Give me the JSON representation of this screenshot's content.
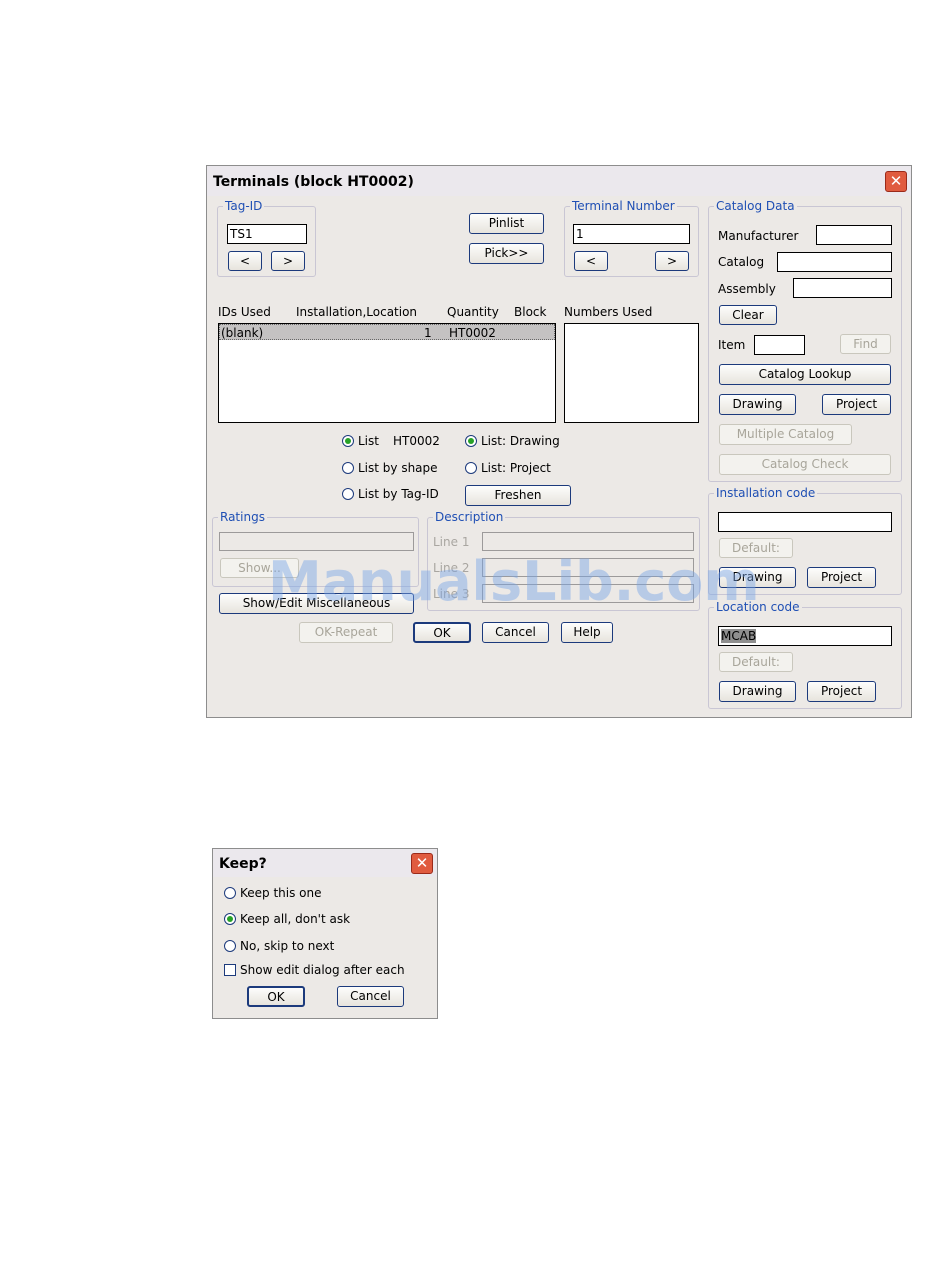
{
  "terminals": {
    "title": "Terminals (block HT0002)",
    "tag_id": {
      "legend": "Tag-ID",
      "value": "TS1",
      "prev": "<",
      "next": ">"
    },
    "pinlist": "Pinlist",
    "pick": "Pick>>",
    "terminal_number": {
      "legend": "Terminal Number",
      "value": "1",
      "prev": "<",
      "next": ">"
    },
    "list_headers": {
      "ids": "IDs Used",
      "inst_loc": "Installation,Location",
      "quantity": "Quantity",
      "block": "Block",
      "numbers": "Numbers Used"
    },
    "ids_rows": [
      {
        "id": "(blank)",
        "inst_loc": "",
        "quantity": "1",
        "block": "HT0002"
      }
    ],
    "radios": {
      "list": "List",
      "list_block": "HT0002",
      "list_by_shape": "List by shape",
      "list_by_tag": "List by Tag-ID",
      "list_drawing": "List: Drawing",
      "list_project": "List: Project"
    },
    "freshen": "Freshen",
    "ratings": {
      "legend": "Ratings",
      "show": "Show..."
    },
    "description": {
      "legend": "Description",
      "line1": "Line 1",
      "line2": "Line 2",
      "line3": "Line 3"
    },
    "show_edit_misc": "Show/Edit Miscellaneous",
    "ok_repeat": "OK-Repeat",
    "ok": "OK",
    "cancel": "Cancel",
    "help": "Help",
    "catalog": {
      "legend": "Catalog Data",
      "manufacturer": "Manufacturer",
      "catalog": "Catalog",
      "assembly": "Assembly",
      "clear": "Clear",
      "item": "Item",
      "find": "Find",
      "catalog_lookup": "Catalog Lookup",
      "drawing": "Drawing",
      "project": "Project",
      "multiple_catalog": "Multiple Catalog",
      "catalog_check": "Catalog Check"
    },
    "installation": {
      "legend": "Installation code",
      "value": "",
      "default": "Default:",
      "drawing": "Drawing",
      "project": "Project"
    },
    "location": {
      "legend": "Location code",
      "value": "MCAB",
      "default": "Default:",
      "drawing": "Drawing",
      "project": "Project"
    }
  },
  "keep": {
    "title": "Keep?",
    "opt1": "Keep this one",
    "opt2": "Keep all, don't ask",
    "opt3": "No, skip to next",
    "check": "Show edit dialog after each",
    "ok": "OK",
    "cancel": "Cancel"
  },
  "watermark": "ManualsLib.com",
  "icons": {
    "close": "close-icon"
  }
}
